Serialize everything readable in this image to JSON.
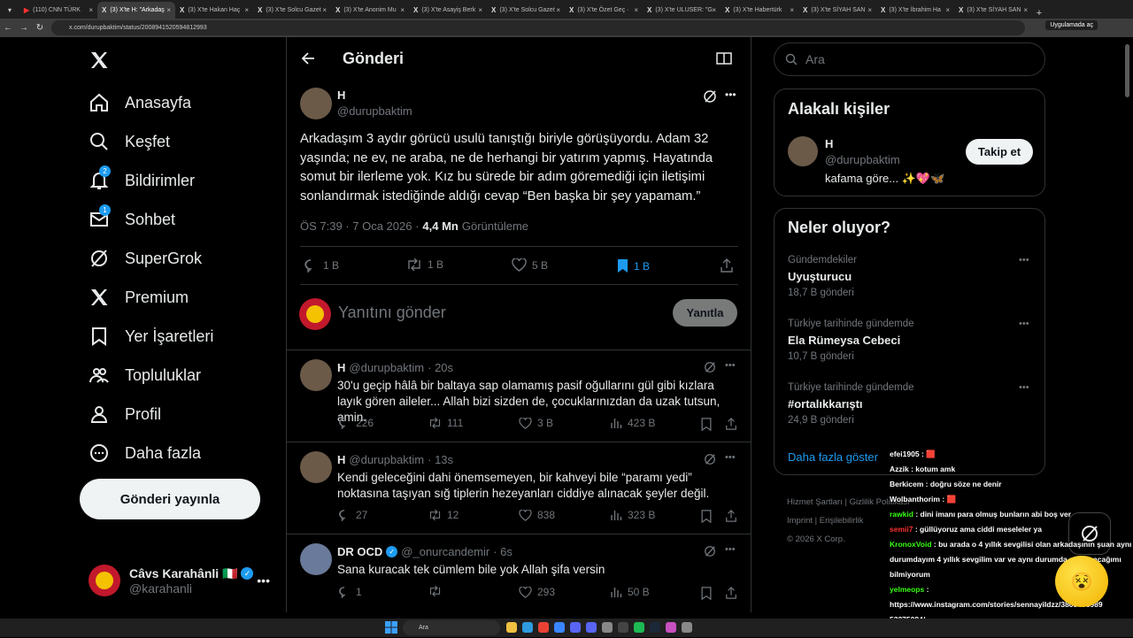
{
  "browser": {
    "tabs": [
      {
        "title": "(110) CNN TÜRK"
      },
      {
        "title": "(3) X'te H: \"Arkadaş"
      },
      {
        "title": "(3) X'te Hakan Haç"
      },
      {
        "title": "(3) X'te Solcu Gazet"
      },
      {
        "title": "(3) X'te Anonim Mu"
      },
      {
        "title": "(3) X'te Asayiş Berk"
      },
      {
        "title": "(3) X'te Solcu Gazet"
      },
      {
        "title": "(3) X'te Özet Geç ·"
      },
      {
        "title": "(3) X'te ULUSER: \"G"
      },
      {
        "title": "(3) X'te Habertürk"
      },
      {
        "title": "(3) X'te SİYAH SAN"
      },
      {
        "title": "(3) X'te İbrahim Ha"
      },
      {
        "title": "(3) X'te SİYAH SAN"
      }
    ],
    "url": "x.com/durupbaktim/status/2008941520594812993",
    "open_in_app": "Uygulamada aç"
  },
  "nav": {
    "items": [
      {
        "label": "Anasayfa",
        "icon": "home-icon"
      },
      {
        "label": "Keşfet",
        "icon": "search-icon"
      },
      {
        "label": "Bildirimler",
        "icon": "bell-icon",
        "badge": "2"
      },
      {
        "label": "Sohbet",
        "icon": "mail-icon",
        "badge": "1"
      },
      {
        "label": "SuperGrok",
        "icon": "grok-icon"
      },
      {
        "label": "Premium",
        "icon": "x-logo-icon"
      },
      {
        "label": "Yer İşaretleri",
        "icon": "bookmark-icon"
      },
      {
        "label": "Topluluklar",
        "icon": "communities-icon"
      },
      {
        "label": "Profil",
        "icon": "profile-icon"
      },
      {
        "label": "Daha fazla",
        "icon": "more-circle-icon"
      }
    ],
    "post_button": "Gönderi yayınla",
    "account": {
      "name": "Câvs Karahânli 🇮🇹",
      "handle": "@karahanli"
    }
  },
  "header": {
    "title": "Gönderi"
  },
  "post": {
    "name": "H",
    "handle": "@durupbaktim",
    "text": "Arkadaşım 3 aydır görücü usulü tanıştığı biriyle görüşüyordu. Adam 32 yaşında; ne ev, ne araba, ne de herhangi bir yatırım yapmış. Hayatında somut bir ilerleme yok. Kız bu sürede bir adım göremediği için iletişimi sonlandırmak istediğinde aldığı cevap “Ben başka bir şey yapamam.”",
    "time": "ÖS 7:39 · 7 Oca 2026 ·",
    "views": "4,4 Mn",
    "views_label": "Görüntüleme",
    "replies": "1 B",
    "reposts": "1 B",
    "likes": "5 B",
    "bookmarks": "1 B"
  },
  "reply_box": {
    "placeholder": "Yanıtını gönder",
    "button": "Yanıtla"
  },
  "replies": [
    {
      "name": "H",
      "handle": "@durupbaktim",
      "time": "· 20s",
      "text": "30'u geçip hâlâ bir baltaya sap olamamış pasif oğullarını gül gibi kızlara layık gören aileler... Allah bizi sizden de, çocuklarınızdan da uzak tutsun, amin.",
      "replies": "226",
      "reposts": "111",
      "likes": "3 B",
      "views": "423 B"
    },
    {
      "name": "H",
      "handle": "@durupbaktim",
      "time": "· 13s",
      "text": "Kendi geleceğini dahi önemsemeyen, bir kahveyi bile “paramı yedi” noktasına taşıyan sığ tiplerin hezeyanları ciddiye alınacak şeyler değil.",
      "replies": "27",
      "reposts": "12",
      "likes": "838",
      "views": "323 B"
    },
    {
      "name": "DR OCD",
      "handle": "@_onurcandemir",
      "time": "· 6s",
      "text": "Sana kuracak tek cümlem bile yok Allah şifa versin",
      "replies": "1",
      "reposts": "",
      "likes": "293",
      "views": "50 B"
    }
  ],
  "search": {
    "placeholder": "Ara"
  },
  "related": {
    "title": "Alakalı kişiler",
    "name": "H",
    "handle": "@durupbaktim",
    "bio": "kafama göre... ✨💖🦋",
    "follow": "Takip et"
  },
  "trends": {
    "title": "Neler oluyor?",
    "items": [
      {
        "context": "Gündemdekiler",
        "name": "Uyuşturucu",
        "count": "18,7 B gönderi"
      },
      {
        "context": "Türkiye tarihinde gündemde",
        "name": "Ela Rümeysa Cebeci",
        "count": "10,7 B gönderi"
      },
      {
        "context": "Türkiye tarihinde gündemde",
        "name": "#ortalıkkarıştı",
        "count": "24,9 B gönderi"
      }
    ],
    "show_more": "Daha fazla göster"
  },
  "footer": {
    "links": [
      "Hizmet Şartları",
      "Gizlilik",
      "Politikası",
      "Imprint",
      "Erişilebilirlik"
    ],
    "copyright": "© 2026 X Corp."
  },
  "chat": [
    {
      "user": "efei1905",
      "color": "#ffffff",
      "msg": ": 🟥"
    },
    {
      "user": "Azzik",
      "color": "#ffffff",
      "msg": ": kotum amk"
    },
    {
      "user": "Berkicem",
      "color": "#ffffff",
      "msg": ": doğru söze ne denir"
    },
    {
      "user": "Wolbanthorim",
      "color": "#ffffff",
      "msg": ": 🟥"
    },
    {
      "user": "rawkid",
      "color": "#39ff14",
      "msg": ": dini imanı para olmuş bunların abi boş ver"
    },
    {
      "user": "semii7",
      "color": "#ff3030",
      "msg": ": güllüyoruz ama ciddi meseleler ya"
    },
    {
      "user": "KronoxVoid",
      "color": "#39ff14",
      "msg": ": bu arada o 4 yıllık sevgilisi olan arkadaşının şuan aynı durumdayım 4 yıllık sevgilim var ve aynı durumda ne yapacağımı bilmiyorum"
    },
    {
      "user": "yelmeops",
      "color": "#39ff14",
      "msg": ": https://www.instagram.com/stories/sennayildzz/3805458989 53275094/"
    }
  ],
  "taskbar": {
    "search": "Ara"
  },
  "colors": {
    "accent": "#1d9bf0",
    "bookmark_active": "#1d9bf0",
    "background": "#000000",
    "border": "#2f3336"
  }
}
